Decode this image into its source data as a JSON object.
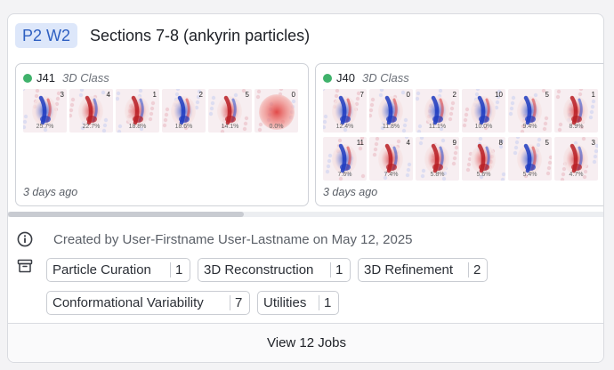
{
  "project": {
    "badge": "P2 W2",
    "title": "Sections 7-8 (ankyrin particles)"
  },
  "jobs": [
    {
      "id": "J41",
      "type": "3D Class",
      "time": "3 days ago",
      "status_color": "#3fb26b",
      "classes": [
        {
          "idx": "3",
          "pct": "25.7%",
          "tone": "blue"
        },
        {
          "idx": "4",
          "pct": "22.7%",
          "tone": "red"
        },
        {
          "idx": "1",
          "pct": "18.8%",
          "tone": "red"
        },
        {
          "idx": "2",
          "pct": "18.6%",
          "tone": "blue"
        },
        {
          "idx": "5",
          "pct": "14.1%",
          "tone": "red"
        },
        {
          "idx": "0",
          "pct": "0.0%",
          "tone": "solid"
        }
      ]
    },
    {
      "id": "J40",
      "type": "3D Class",
      "time": "3 days ago",
      "status_color": "#3fb26b",
      "classes": [
        {
          "idx": "7",
          "pct": "12.4%",
          "tone": "blue"
        },
        {
          "idx": "0",
          "pct": "11.8%",
          "tone": "blue"
        },
        {
          "idx": "2",
          "pct": "11.1%",
          "tone": "blue"
        },
        {
          "idx": "10",
          "pct": "10.0%",
          "tone": "blue"
        },
        {
          "idx": "5",
          "pct": "9.4%",
          "tone": "blue"
        },
        {
          "idx": "1",
          "pct": "8.9%",
          "tone": "red"
        },
        {
          "idx": "11",
          "pct": "7.6%",
          "tone": "blue"
        },
        {
          "idx": "4",
          "pct": "7.4%",
          "tone": "red"
        },
        {
          "idx": "9",
          "pct": "5.8%",
          "tone": "red"
        },
        {
          "idx": "8",
          "pct": "5.6%",
          "tone": "red"
        },
        {
          "idx": "5",
          "pct": "5.4%",
          "tone": "blue"
        },
        {
          "idx": "3",
          "pct": "4.7%",
          "tone": "red"
        }
      ]
    }
  ],
  "meta": {
    "created": "Created by User-Firstname User-Lastname on May 12, 2025"
  },
  "tags": [
    {
      "label": "Particle Curation",
      "count": "1"
    },
    {
      "label": "3D Reconstruction",
      "count": "1"
    },
    {
      "label": "3D Refinement",
      "count": "2"
    },
    {
      "label": "Conformational Variability",
      "count": "7"
    },
    {
      "label": "Utilities",
      "count": "1"
    }
  ],
  "footer": {
    "view_jobs": "View 12 Jobs"
  },
  "icons": {
    "info": "info-circle-icon",
    "category": "archive-box-icon",
    "status": "status-dot-icon"
  },
  "colors": {
    "accent": "#2e5fc1",
    "badge_bg": "#dde7fa",
    "status_ok": "#3fb26b"
  }
}
